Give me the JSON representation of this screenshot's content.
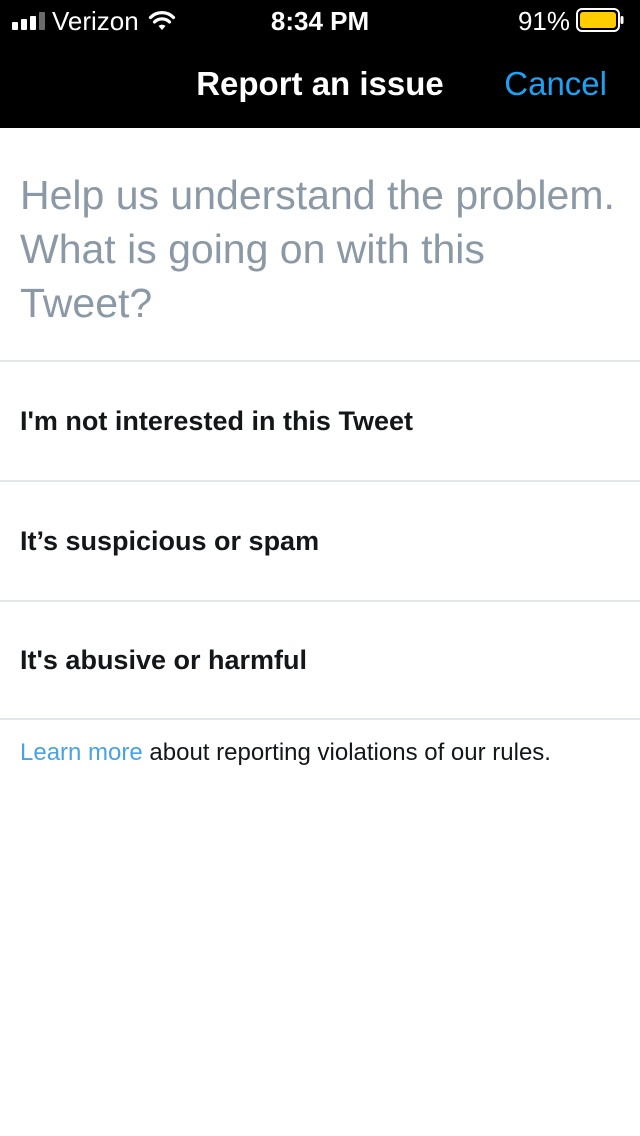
{
  "status_bar": {
    "carrier": "Verizon",
    "time": "8:34 PM",
    "battery_percent": "91%",
    "battery_level": 0.91,
    "signal_bars": 3,
    "signal_bars_total": 4,
    "battery_color": "#ffcc00"
  },
  "nav": {
    "title": "Report an issue",
    "cancel_label": "Cancel"
  },
  "prompt": "Help us understand the problem. What is going on with this Tweet?",
  "options": [
    {
      "label": "I'm not interested in this Tweet"
    },
    {
      "label": "It’s suspicious or spam"
    },
    {
      "label": "It's abusive or harmful"
    }
  ],
  "footer": {
    "link_text": "Learn more",
    "text": " about reporting violations of our rules."
  },
  "colors": {
    "accent": "#1da1f2",
    "link": "#4aa3df",
    "prompt_text": "#8b98a5",
    "divider": "#e1e8ed"
  }
}
